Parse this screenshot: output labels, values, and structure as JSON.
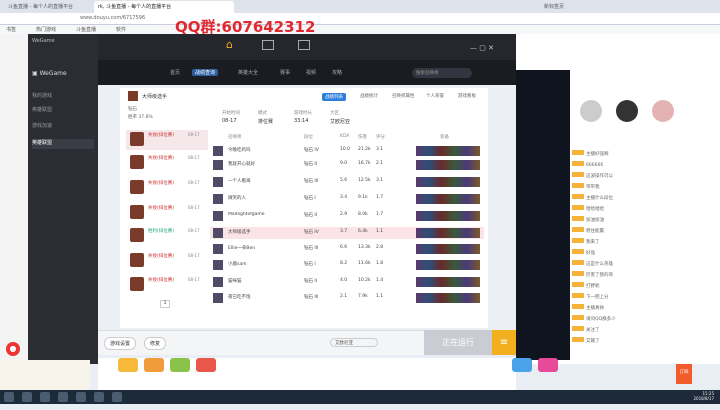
{
  "browser": {
    "tabs": [
      "斗鱼直播 - 每个人的直播平台",
      "直播间",
      "哔哩哔哩直播",
      "新标签页"
    ],
    "active_tab": "rk, 斗鱼直播 - 每个人的直播平台",
    "url": "www.douyu.com/6717596",
    "bookmarks": [
      "书签",
      "热门游戏",
      "斗鱼直播",
      "软件",
      "游戏",
      "视频"
    ]
  },
  "overlay": {
    "qq_group": "QQ群:607642312"
  },
  "wegame": {
    "app_name": "WeGame",
    "top_icons": [
      "home-icon",
      "library-icon",
      "video-icon"
    ],
    "sidebar": [
      {
        "label": "我的游戏"
      },
      {
        "label": "英雄联盟"
      },
      {
        "label": "游戏加速"
      },
      {
        "label": "英雄联盟"
      }
    ],
    "game_tabs": [
      "首页",
      "战绩查询",
      "英雄大全",
      "赛事",
      "视频",
      "攻略"
    ],
    "active_game_tab": "战绩查询",
    "search_placeholder": "搜索召唤师",
    "summoner": {
      "name": "大师级选手",
      "level": "300",
      "tier": "钻石",
      "wins": "胜 0 场",
      "rate": "胜率 37.8%"
    },
    "stats_tabs": [
      "战绩列表",
      "战绩统计",
      "召唤师属性",
      "个人荣誉",
      "游戏看板"
    ],
    "stats_labels": [
      "开始时间",
      "模式",
      "游戏时长",
      "大区"
    ],
    "stats_values": [
      "08-17",
      "排位赛",
      "33:14",
      "艾欧尼亚"
    ],
    "table_headers": [
      "召唤师",
      "段位",
      "KDA",
      "伤害",
      "评分",
      "装备"
    ],
    "matches": [
      {
        "result": "失败(排位赛)",
        "date": "08-17"
      },
      {
        "result": "失败(排位赛)",
        "date": "08-17"
      },
      {
        "result": "失败(排位赛)",
        "date": "08-17"
      },
      {
        "result": "失败(排位赛)",
        "date": "08-17"
      },
      {
        "result": "胜利(排位赛)",
        "date": "08-17"
      },
      {
        "result": "失败(排位赛)",
        "date": "08-17"
      },
      {
        "result": "失败(排位赛)",
        "date": "08-17"
      },
      {
        "result": "失败(排位赛)",
        "date": "08-17"
      }
    ],
    "players": [
      {
        "name": "今晚吃鸡吗",
        "rank": "钻石 IV",
        "kda": "10.0",
        "dmg": "21.2k",
        "rating": "3.1"
      },
      {
        "name": "我就开心就好",
        "rank": "钻石 II",
        "kda": "9.0",
        "dmg": "16.7k",
        "rating": "2.1"
      },
      {
        "name": "一个人看海",
        "rank": "钻石 III",
        "kda": "5.6",
        "dmg": "12.5k",
        "rating": "3.1"
      },
      {
        "name": "微笑的人",
        "rank": "钻石 I",
        "kda": "3.4",
        "dmg": "9.1k",
        "rating": "1.7"
      },
      {
        "name": "Madlightofgame",
        "rank": "钻石 II",
        "kda": "2.9",
        "dmg": "8.0k",
        "rating": "1.7"
      },
      {
        "name": "大师级选手",
        "rank": "钻石 IV",
        "kda": "3.7",
        "dmg": "6.4k",
        "rating": "1.1"
      },
      {
        "name": "Ellie一朵Ben",
        "rank": "钻石 III",
        "kda": "6.6",
        "dmg": "13.3k",
        "rating": "2.8"
      },
      {
        "name": "小鹿sam",
        "rank": "钻石 I",
        "kda": "8.2",
        "dmg": "11.6k",
        "rating": "1.8"
      },
      {
        "name": "猫咪猫",
        "rank": "钻石 II",
        "kda": "4.0",
        "dmg": "10.2k",
        "rating": "1.4"
      },
      {
        "name": "夜已吃不饱",
        "rank": "钻石 III",
        "kda": "2.1",
        "dmg": "7.9k",
        "rating": "1.1"
      }
    ],
    "pagination": "1",
    "bottom_buttons": [
      "游戏设置",
      "修复"
    ],
    "region_select": "艾欧尼亚",
    "run_button": "正在运行"
  },
  "stream": {
    "chat_lines": [
      "主播好强啊",
      "666666",
      "这波操作可以",
      "带带我",
      "主播什么段位",
      "哈哈哈哈",
      "加油加油",
      "稳住能赢",
      "我来了",
      "好强",
      "这是什么英雄",
      "厉害了我的哥",
      "打野呢",
      "下一把上分",
      "主播真帅",
      "请问QQ群多少",
      "关注了",
      "又输了",
      "送个礼物",
      "晚上好"
    ],
    "follow_button": "订阅",
    "send_button": "发送"
  },
  "taskbar": {
    "time": "15:25",
    "date": "2018/8/17"
  }
}
